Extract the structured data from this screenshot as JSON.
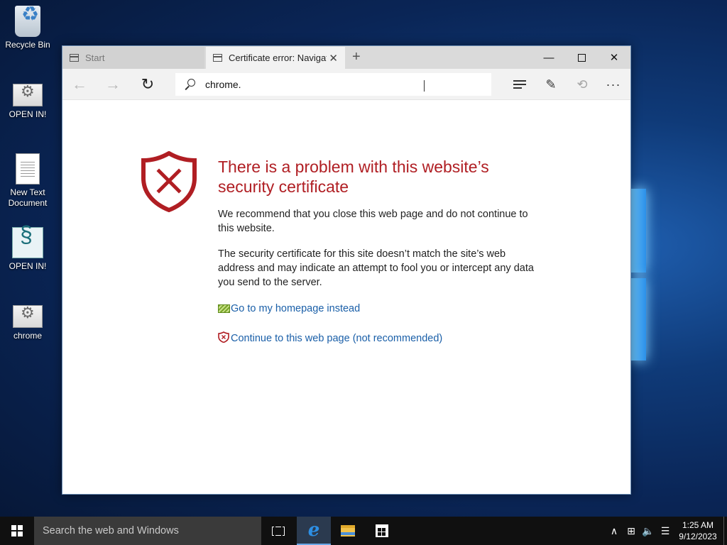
{
  "desktop": {
    "icons": [
      {
        "label": "Recycle Bin"
      },
      {
        "label": "OPEN IN!"
      },
      {
        "label": "New Text\nDocument"
      },
      {
        "label": "OPEN IN!"
      },
      {
        "label": "chrome"
      }
    ]
  },
  "browser": {
    "tabs": [
      {
        "title": "Start"
      },
      {
        "title": "Certificate error: Navigati"
      }
    ],
    "new_tab_glyph": "+",
    "close_tab_glyph": "✕",
    "window_controls": {
      "minimize": "—",
      "close": "✕"
    },
    "address_bar": {
      "value": "chrome."
    },
    "nav": {
      "back": "←",
      "forward": "→",
      "refresh": "↻"
    },
    "toolbar": {
      "note": "✎",
      "share": "⟲",
      "more": "···"
    }
  },
  "error_page": {
    "title": "There is a problem with this website’s security certificate",
    "paragraph1": "We recommend that you close this web page and do not continue to this website.",
    "paragraph2": "The security certificate for this site doesn’t match the site’s web address and may indicate an attempt to fool you or intercept any data you send to the server.",
    "link_home": "Go to my homepage instead",
    "link_continue": "Continue to this web page (not recommended)",
    "accent_color": "#b01e23",
    "link_color": "#1a5fa8"
  },
  "taskbar": {
    "search_placeholder": "Search the web and Windows",
    "edge_glyph": "e",
    "tray": {
      "chevron": "∧",
      "network": "⊞",
      "volume": "🔈",
      "messages": "☰"
    },
    "clock_time": "1:25 AM",
    "clock_date": "9/12/2023"
  }
}
